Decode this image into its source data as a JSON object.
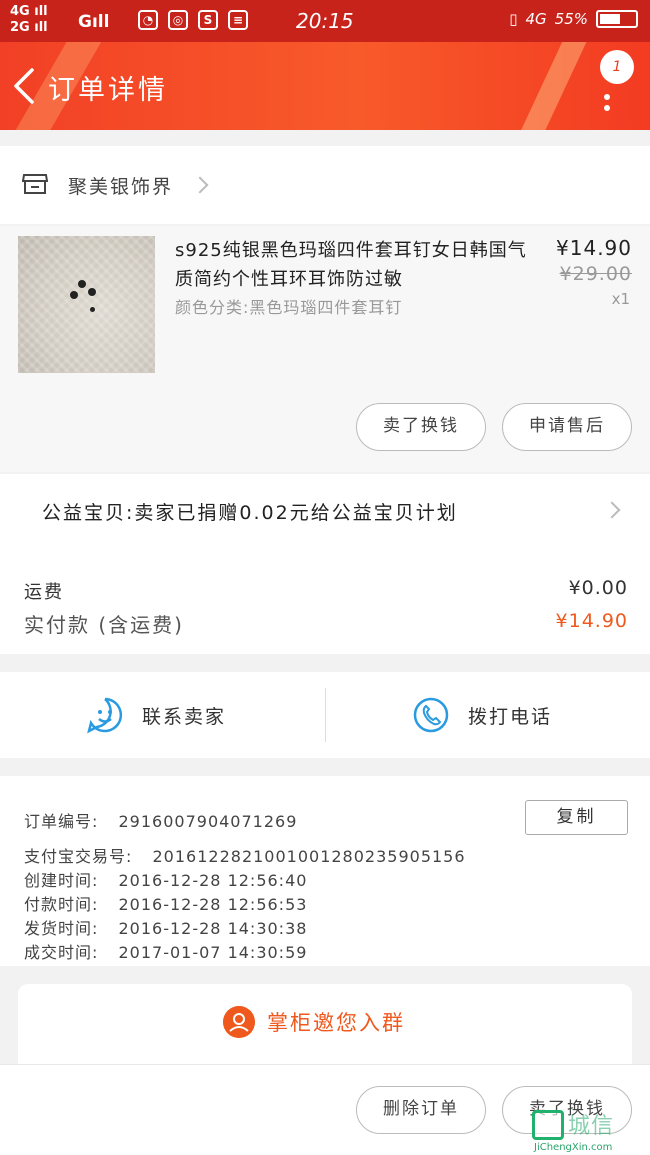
{
  "status_bar": {
    "network_top": "4G",
    "network_bottom": "2G",
    "network_g": "G",
    "time": "20:15",
    "network_right": "4G",
    "battery": "55%"
  },
  "header": {
    "title": "订单详情",
    "badge_count": "1"
  },
  "shop": {
    "name": "聚美银饰界"
  },
  "product": {
    "title": "s925纯银黑色玛瑙四件套耳钉女日韩国气质简约个性耳环耳饰防过敏",
    "spec": "颜色分类:黑色玛瑙四件套耳钉",
    "price": "¥14.90",
    "original_price": "¥29.00",
    "quantity": "x1",
    "buttons": {
      "exchange": "卖了换钱",
      "after_sale": "申请售后"
    }
  },
  "charity": {
    "text": "公益宝贝:卖家已捐赠0.02元给公益宝贝计划"
  },
  "fees": {
    "shipping_label": "运费",
    "shipping_value": "¥0.00",
    "paid_label": "实付款 (含运费)",
    "paid_value": "¥14.90",
    "paid_color": "#f0591e"
  },
  "contact": {
    "seller": "联系卖家",
    "phone": "拨打电话",
    "icon_color": "#2a9be0"
  },
  "order_info": {
    "order_no_label": "订单编号:",
    "order_no": "2916007904071269",
    "copy_label": "复制",
    "alipay_label": "支付宝交易号:",
    "alipay_no": "2016122821001001280235905156",
    "created_label": "创建时间:",
    "created": "2016-12-28 12:56:40",
    "paid_label": "付款时间:",
    "paid": "2016-12-28 12:56:53",
    "shipped_label": "发货时间:",
    "shipped": "2016-12-28 14:30:38",
    "done_label": "成交时间:",
    "done": "2017-01-07 14:30:59"
  },
  "group": {
    "label": "掌柜邀您入群"
  },
  "bottom_bar": {
    "delete": "删除订单",
    "exchange": "卖了换钱"
  },
  "watermark": {
    "text": "城信",
    "url": "JiChengXin.com"
  }
}
